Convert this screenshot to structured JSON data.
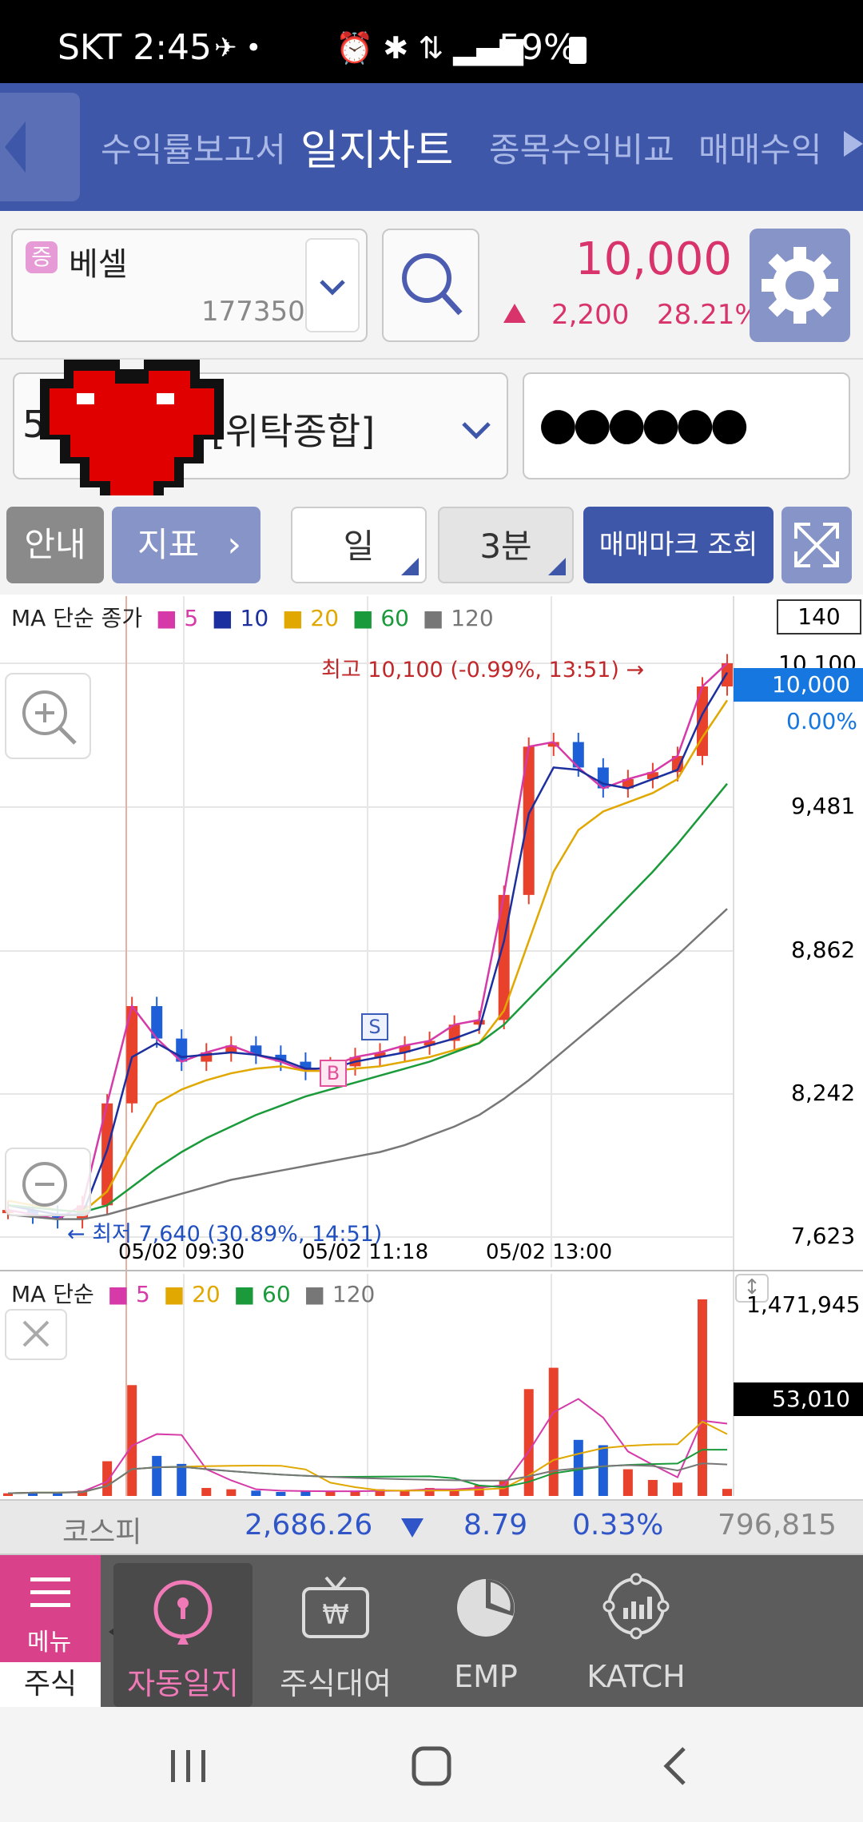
{
  "status_bar": {
    "carrier_time": "SKT 2:45",
    "battery": "59%"
  },
  "tabs": [
    {
      "label": "수익률보고서"
    },
    {
      "label": "일지차트"
    },
    {
      "label": "종목수익비교"
    },
    {
      "label": "매매수익"
    }
  ],
  "stock": {
    "badge": "증",
    "name": "베셀",
    "code": "177350",
    "price": "10,000",
    "change": "2,200",
    "change_pct": "28.21%"
  },
  "account": {
    "number": "5",
    "type": "[위탁종합]",
    "password": "●●●●●●"
  },
  "controls": {
    "guide": "안내",
    "indicator": "지표",
    "period": "일",
    "interval": "3분",
    "trade_mark": "매매마크 조회"
  },
  "price_chart": {
    "legend_title": "MA 단순 종가",
    "legend": [
      {
        "label": "5",
        "color": "#d63aa8"
      },
      {
        "label": "10",
        "color": "#1c2f9e"
      },
      {
        "label": "20",
        "color": "#e0a800"
      },
      {
        "label": "60",
        "color": "#1a9a3a"
      },
      {
        "label": "120",
        "color": "#777777"
      }
    ],
    "top_box": "140",
    "current_price": "10,000",
    "current_pct": "0.00%",
    "y_ticks": [
      "10,100",
      "9,481",
      "8,862",
      "8,242",
      "7,623"
    ],
    "x_ticks": [
      "05/02 09:30",
      "05/02 11:18",
      "05/02 13:00"
    ],
    "high_annotation": "최고 10,100 (-0.99%, 13:51) →",
    "low_annotation": "← 최저 7,640 (30.89%, 14:51)",
    "buy_mark": "B",
    "sell_mark": "S"
  },
  "volume_chart": {
    "legend_title": "MA 단순",
    "legend": [
      {
        "label": "5",
        "color": "#d63aa8"
      },
      {
        "label": "20",
        "color": "#e0a800"
      },
      {
        "label": "60",
        "color": "#1a9a3a"
      },
      {
        "label": "120",
        "color": "#777777"
      }
    ],
    "max_label": "1,471,945",
    "current_volume": "53,010"
  },
  "chart_data": [
    {
      "type": "line",
      "title": "MA 단순 종가",
      "x_ticks": [
        "05/02 09:30",
        "05/02 11:18",
        "05/02 13:00"
      ],
      "y_ticks": [
        10100,
        9481,
        8862,
        8242,
        7623
      ],
      "ylim": [
        7623,
        10100
      ],
      "series": [
        {
          "name": "5",
          "values": [
            7740,
            7720,
            7700,
            7760,
            8200,
            8620,
            8480,
            8380,
            8420,
            8450,
            8410,
            8380,
            8340,
            8360,
            8400,
            8420,
            8450,
            8470,
            8540,
            8560,
            9100,
            9740,
            9760,
            9650,
            9560,
            9600,
            9630,
            9700,
            10000,
            10100
          ]
        },
        {
          "name": "10",
          "values": [
            7760,
            7740,
            7720,
            7720,
            8000,
            8400,
            8460,
            8400,
            8410,
            8420,
            8410,
            8390,
            8350,
            8350,
            8380,
            8400,
            8420,
            8450,
            8480,
            8520,
            8900,
            9450,
            9650,
            9640,
            9580,
            9560,
            9600,
            9640,
            9880,
            10060
          ]
        },
        {
          "name": "20",
          "values": [
            7780,
            7760,
            7740,
            7730,
            7820,
            8020,
            8200,
            8260,
            8300,
            8330,
            8350,
            8360,
            8340,
            8340,
            8350,
            8360,
            8380,
            8400,
            8430,
            8460,
            8600,
            8900,
            9200,
            9380,
            9460,
            9500,
            9540,
            9600,
            9780,
            9940
          ]
        },
        {
          "name": "60",
          "values": [
            7760,
            7750,
            7740,
            7730,
            7760,
            7840,
            7920,
            7990,
            8050,
            8100,
            8150,
            8190,
            8230,
            8260,
            8290,
            8320,
            8350,
            8380,
            8420,
            8460,
            8540,
            8650,
            8760,
            8870,
            8980,
            9090,
            9200,
            9320,
            9450,
            9580
          ]
        },
        {
          "name": "120",
          "values": [
            7720,
            7710,
            7700,
            7700,
            7720,
            7750,
            7780,
            7810,
            7840,
            7870,
            7890,
            7910,
            7930,
            7950,
            7970,
            7990,
            8020,
            8060,
            8100,
            8150,
            8220,
            8300,
            8390,
            8480,
            8570,
            8660,
            8750,
            8840,
            8940,
            9040
          ]
        }
      ]
    },
    {
      "type": "bar",
      "title": "MA 단순",
      "ylim": [
        0,
        1471945
      ],
      "series": [
        {
          "name": "volume",
          "values": [
            20000,
            30000,
            25000,
            40000,
            260000,
            830000,
            300000,
            240000,
            60000,
            50000,
            40000,
            30000,
            40000,
            35000,
            30000,
            50000,
            40000,
            60000,
            45000,
            80000,
            120000,
            800000,
            960000,
            420000,
            380000,
            200000,
            120000,
            100000,
            1471945,
            53010
          ]
        }
      ]
    }
  ],
  "kospi": {
    "label": "코스피",
    "value": "2,686.26",
    "change": "8.79",
    "pct": "0.33%",
    "volume": "796,815"
  },
  "bottom_nav": [
    {
      "label": "메뉴"
    },
    {
      "label": "주식"
    },
    {
      "label": "자동일지"
    },
    {
      "label": "주식대여"
    },
    {
      "label": "EMP"
    },
    {
      "label": "KATCH"
    }
  ]
}
